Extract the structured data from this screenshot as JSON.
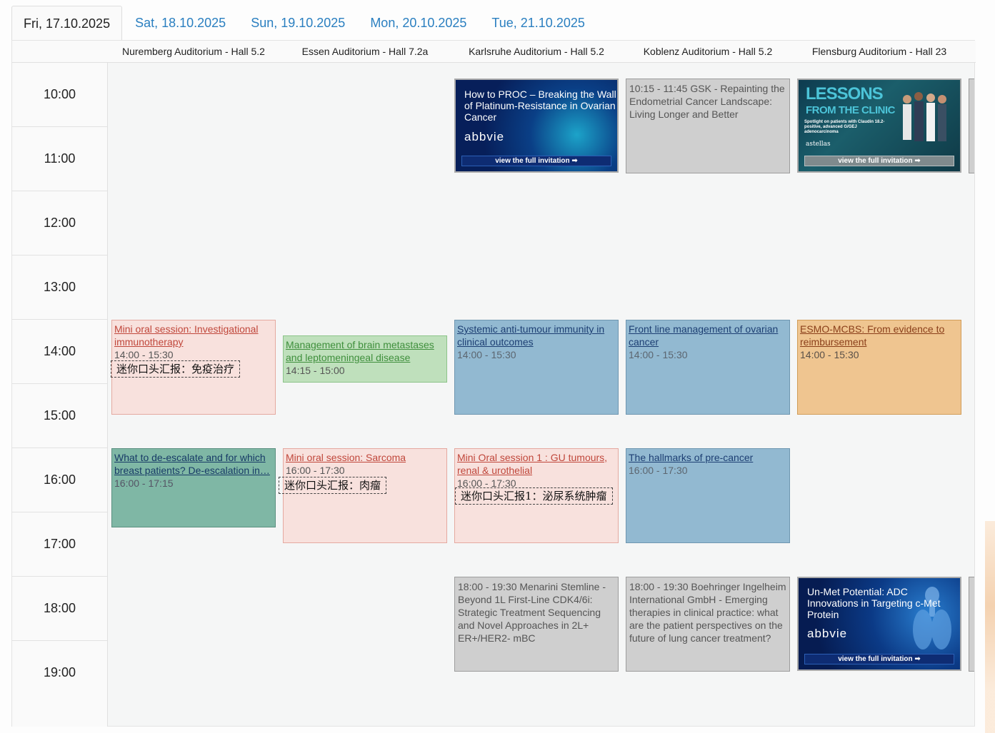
{
  "tabs": [
    {
      "label": "Fri, 17.10.2025",
      "active": true
    },
    {
      "label": "Sat, 18.10.2025",
      "active": false
    },
    {
      "label": "Sun, 19.10.2025",
      "active": false
    },
    {
      "label": "Mon, 20.10.2025",
      "active": false
    },
    {
      "label": "Tue, 21.10.2025",
      "active": false
    }
  ],
  "halls": [
    "Nuremberg Auditorium - Hall 5.2",
    "Essen Auditorium - Hall 7.2a",
    "Karlsruhe Auditorium - Hall 5.2",
    "Koblenz Auditorium - Hall 5.2",
    "Flensburg Auditorium - Hall 23"
  ],
  "times": [
    "10:00",
    "11:00",
    "12:00",
    "13:00",
    "14:00",
    "15:00",
    "16:00",
    "17:00",
    "18:00",
    "19:00"
  ],
  "events": {
    "nuremberg_1": {
      "title": "Mini oral session: Investigational immunotherapy",
      "time": "14:00 - 15:30",
      "note": "迷你口头汇报：免疫治疗"
    },
    "nuremberg_2": {
      "title": "What to de-escalate and for which breast patients? De-escalation in…",
      "time": "16:00 - 17:15"
    },
    "essen_1": {
      "title": "Management of brain metastases and leptomeningeal disease",
      "time": "14:15 - 15:00"
    },
    "essen_2": {
      "title": "Mini oral session: Sarcoma",
      "time": "16:00 - 17:30",
      "note": "迷你口头汇报：肉瘤"
    },
    "karlsruhe_1": {
      "title": "Systemic anti-tumour immunity in clinical outcomes",
      "time": "14:00 - 15:30"
    },
    "karlsruhe_2": {
      "title": "Mini Oral session 1 : GU tumours, renal & urothelial",
      "time": "16:00 - 17:30",
      "note": "迷你口头汇报1：泌尿系统肿瘤"
    },
    "karlsruhe_3": {
      "text": "18:00 - 19:30 Menarini Stemline - Beyond 1L First-Line CDK4/6i: Strategic Treatment Sequencing and Novel Approaches in 2L+ ER+/HER2- mBC"
    },
    "koblenz_0": {
      "text": "10:15 - 11:45 GSK - Repainting the Endometrial Cancer Landscape: Living Longer and Better"
    },
    "koblenz_1": {
      "title": "Front line management of ovarian cancer",
      "time": "14:00 - 15:30"
    },
    "koblenz_2": {
      "title": "The hallmarks of pre-cancer",
      "time": "16:00 - 17:30"
    },
    "koblenz_3": {
      "text": "18:00 - 19:30 Boehringer Ingelheim International GmbH - Emerging therapies in clinical practice: what are the patient perspectives on the future of lung cancer treatment?"
    },
    "flensburg_1": {
      "title": "ESMO-MCBS: From evidence to reimbursement",
      "time": "14:00 - 15:30"
    }
  },
  "ads": {
    "karlsruhe_abbvie": {
      "text": "How to PROC – Breaking the Wall of Platinum-Resistance in Ovarian Cancer",
      "logo": "abbvie",
      "button": "view the full invitation"
    },
    "flensburg_astellas": {
      "headline_1": "LESSONS",
      "headline_2": "FROM THE CLINIC",
      "subtext": "Spotlight on patients with Claudin 18.2-positive, advanced G/GEJ adenocarcinoma",
      "logo": "astellas",
      "button": "view the full invitation"
    },
    "flensburg_abbvie": {
      "text": "Un-Met Potential: ADC Innovations in Targeting c-Met Protein",
      "logo": "abbvie",
      "button": "view the full invitation"
    }
  },
  "colors": {
    "tab_link": "#2a7fc0",
    "red_event": "#f8e1dd",
    "green_event": "#bfe0bc",
    "blue_event": "#92b9d1",
    "teal_event": "#7fb7a5",
    "orange_event": "#efc590",
    "grey_event": "#cfcfcf"
  }
}
